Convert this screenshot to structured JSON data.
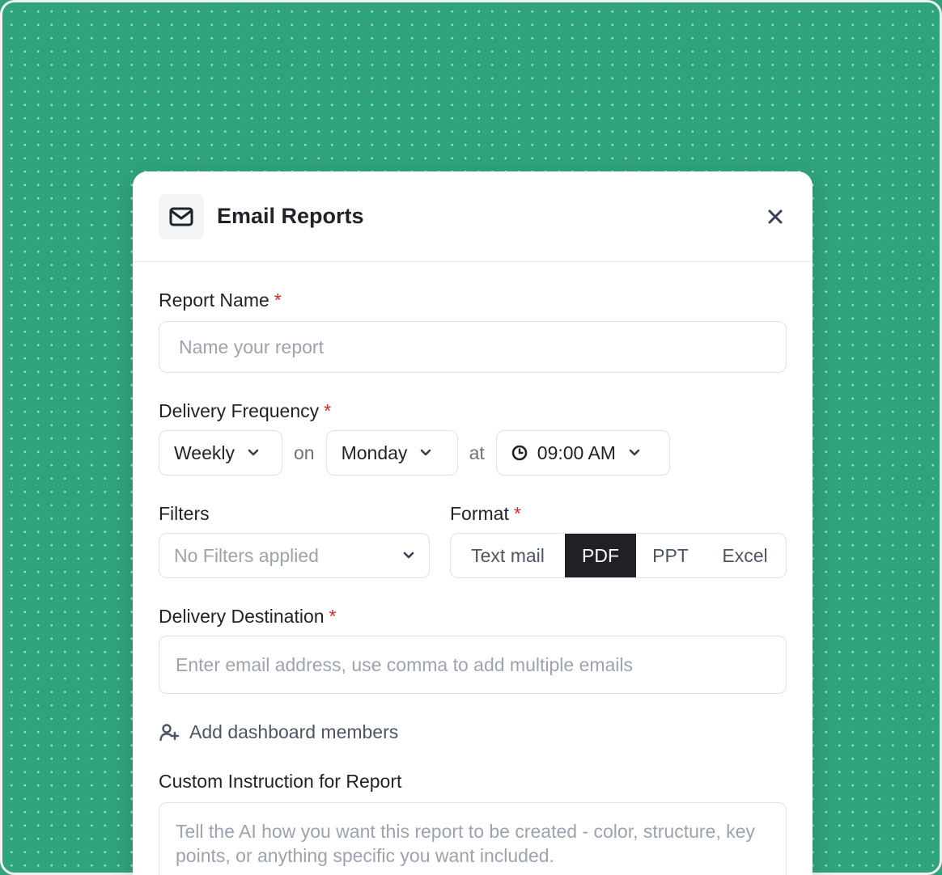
{
  "modal": {
    "title": "Email Reports",
    "header_icon": "mail-icon",
    "close_icon": "close-icon"
  },
  "report_name": {
    "label": "Report Name",
    "required": "*",
    "placeholder": "Name your report",
    "value": ""
  },
  "delivery_frequency": {
    "label": "Delivery Frequency",
    "required": "*",
    "frequency": "Weekly",
    "on_text": "on",
    "day": "Monday",
    "at_text": "at",
    "time": "09:00 AM"
  },
  "filters": {
    "label": "Filters",
    "placeholder": "No Filters applied"
  },
  "format": {
    "label": "Format",
    "required": "*",
    "options": [
      "Text mail",
      "PDF",
      "PPT",
      "Excel"
    ],
    "selected": "PDF"
  },
  "delivery_destination": {
    "label": "Delivery Destination",
    "required": "*",
    "placeholder": "Enter email address, use comma to add multiple emails",
    "value": ""
  },
  "add_members": {
    "label": "Add dashboard members",
    "icon": "user-plus-icon"
  },
  "custom_instruction": {
    "label": "Custom Instruction for Report",
    "placeholder": "Tell the AI how you want this report to be created - color, structure, key points, or anything specific you want included."
  },
  "colors": {
    "background": "#2fa37a",
    "selected_segment": "#1f2124",
    "required_marker": "#dc2626"
  }
}
